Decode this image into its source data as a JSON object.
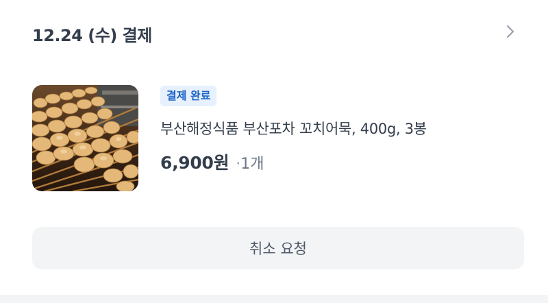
{
  "order": {
    "date_label": "12.24 (수) 결제",
    "detail_icon": "chevron-right-icon",
    "status": "결제 완료",
    "product_name": "부산해정식품 부산포차 꼬치어묵, 400g, 3봉",
    "price": "6,900원",
    "separator": "·",
    "quantity": "1개",
    "cancel_label": "취소 요청"
  },
  "colors": {
    "badge_bg": "#e7f0fd",
    "badge_text": "#1c64c8",
    "button_bg": "#f2f4f6",
    "primary_text": "#333d4b"
  }
}
